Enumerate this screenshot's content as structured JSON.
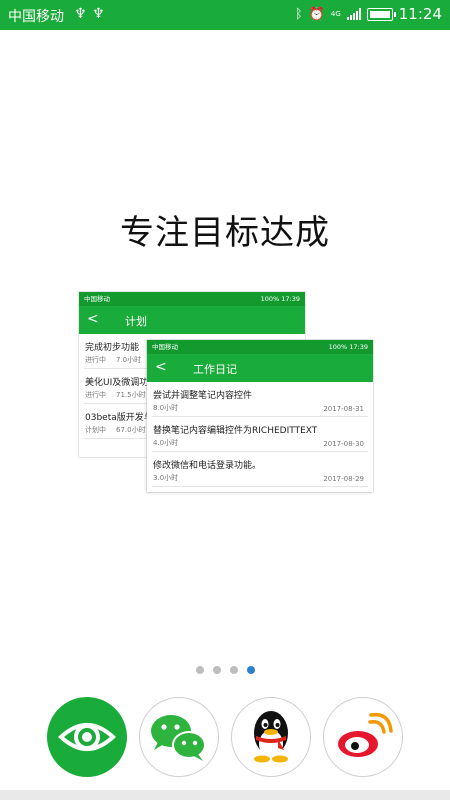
{
  "status_bar": {
    "carrier": "中国移动",
    "network": "4G",
    "time": "11:24",
    "icons": [
      "usb-icon",
      "usb-icon",
      "bluetooth-icon",
      "alarm-icon",
      "signal-icon",
      "battery-icon"
    ]
  },
  "headline": "专注目标达成",
  "plan_screen": {
    "status_carrier": "中国移动",
    "status_right": "100% 17:39",
    "title": "计划",
    "items": [
      {
        "title": "完成初步功能",
        "status": "进行中",
        "hours": "7.0小时"
      },
      {
        "title": "美化UI及微调功能",
        "status": "进行中",
        "hours": "71.5小时"
      },
      {
        "title": "03beta版开发与测试",
        "status": "计划中",
        "hours": "67.0小时"
      }
    ]
  },
  "diary_screen": {
    "status_carrier": "中国移动",
    "status_right": "100% 17:39",
    "title": "工作日记",
    "items": [
      {
        "title": "尝试并调整笔记内容控件",
        "hours": "8.0小时",
        "date": "2017-08-31"
      },
      {
        "title": "替换笔记内容编辑控件为RICHEDITTEXT",
        "hours": "4.0小时",
        "date": "2017-08-30"
      },
      {
        "title": "修改微信和电话登录功能。",
        "hours": "3.0小时",
        "date": "2017-08-29"
      }
    ]
  },
  "pager": {
    "count": 4,
    "active_index": 4
  },
  "share_buttons": [
    {
      "name": "eye",
      "icon": "eye-icon",
      "color": "#1aac3a"
    },
    {
      "name": "wechat",
      "icon": "wechat-icon",
      "color": "#2fb33f"
    },
    {
      "name": "qq",
      "icon": "qq-penguin-icon",
      "color": "#111111"
    },
    {
      "name": "weibo",
      "icon": "weibo-icon",
      "color": "#e6162d"
    }
  ],
  "colors": {
    "brand_green": "#1aac3a",
    "dot_inactive": "#bdbdbd",
    "dot_active": "#2e7fd1"
  }
}
